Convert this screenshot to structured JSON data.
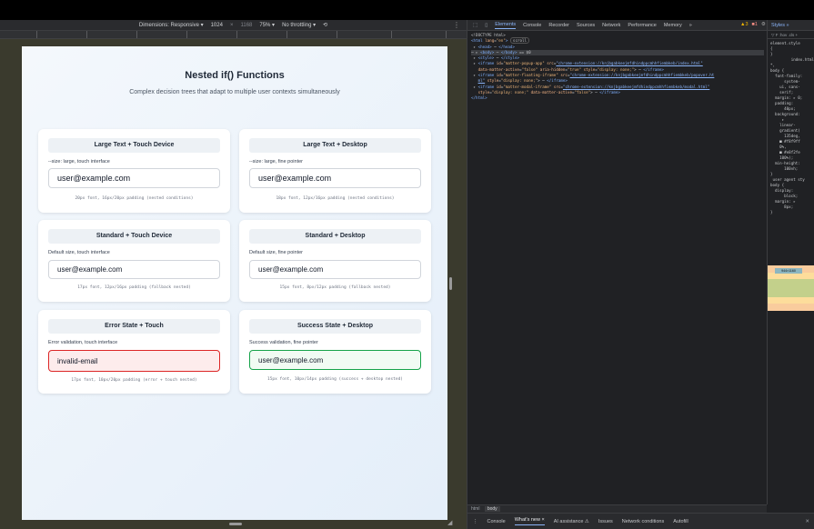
{
  "devbar": {
    "dimensions_label": "Dimensions: Responsive ▾",
    "width": "1024",
    "x": "×",
    "height": "1168",
    "zoom": "75% ▾",
    "throttle": "No throttling ▾"
  },
  "page": {
    "title": "Nested if() Functions",
    "subtitle": "Complex decision trees that adapt to multiple user contexts simultaneously",
    "cards": [
      {
        "header": "Large Text + Touch Device",
        "desc": "--size: large, touch interface",
        "value": "user@example.com",
        "meta": "20px font, 16px/20px padding (nested conditions)"
      },
      {
        "header": "Large Text + Desktop",
        "desc": "--size: large, fine pointer",
        "value": "user@example.com",
        "meta": "18px font, 12px/16px padding (nested conditions)"
      },
      {
        "header": "Standard + Touch Device",
        "desc": "Default size, touch interface",
        "value": "user@example.com",
        "meta": "17px font, 12px/16px padding (fallback nested)"
      },
      {
        "header": "Standard + Desktop",
        "desc": "Default size, fine pointer",
        "value": "user@example.com",
        "meta": "15px font, 8px/12px padding (fallback nested)"
      },
      {
        "header": "Error State + Touch",
        "desc": "Error validation, touch interface",
        "value": "invalid-email",
        "meta": "17px font, 10px/20px padding (error + touch nested)"
      },
      {
        "header": "Success State + Desktop",
        "desc": "Success validation, fine pointer",
        "value": "user@example.com",
        "meta": "15px font, 10px/14px padding (success + desktop nested)"
      }
    ]
  },
  "devtools": {
    "tabs": [
      "Elements",
      "Console",
      "Recorder",
      "Sources",
      "Network",
      "Performance",
      "Memory",
      "»"
    ],
    "warn_count": "▲3",
    "err_count": "■1",
    "breadcrumb": [
      "html",
      "body"
    ],
    "drawer_tabs": [
      "Console",
      "What's new ×",
      "AI assistance ⚠",
      "Issues",
      "Network conditions",
      "Autofill"
    ],
    "styles_tab": "Styles  »",
    "styles_filter": "▽ F  :hov .cls  +"
  },
  "colors": {
    "error_border": "#dc2626",
    "success_border": "#16a34a",
    "accent": "#8ab4f8"
  }
}
